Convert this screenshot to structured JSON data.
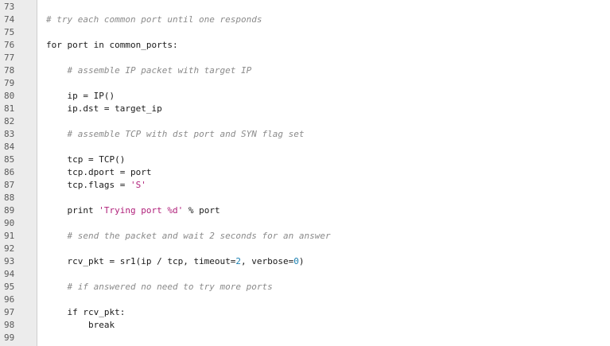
{
  "editor": {
    "lines": [
      {
        "number": "73",
        "indent": "",
        "tokens": []
      },
      {
        "number": "74",
        "indent": "",
        "tokens": [
          {
            "type": "comment",
            "text": "# try each common port until one responds"
          }
        ]
      },
      {
        "number": "75",
        "indent": "",
        "tokens": []
      },
      {
        "number": "76",
        "indent": "",
        "tokens": [
          {
            "type": "plain",
            "text": "for port in common_ports:"
          }
        ]
      },
      {
        "number": "77",
        "indent": "",
        "tokens": []
      },
      {
        "number": "78",
        "indent": "    ",
        "tokens": [
          {
            "type": "comment",
            "text": "# assemble IP packet with target IP"
          }
        ]
      },
      {
        "number": "79",
        "indent": "",
        "tokens": []
      },
      {
        "number": "80",
        "indent": "    ",
        "tokens": [
          {
            "type": "plain",
            "text": "ip = IP()"
          }
        ]
      },
      {
        "number": "81",
        "indent": "    ",
        "tokens": [
          {
            "type": "plain",
            "text": "ip.dst = target_ip"
          }
        ]
      },
      {
        "number": "82",
        "indent": "",
        "tokens": []
      },
      {
        "number": "83",
        "indent": "    ",
        "tokens": [
          {
            "type": "comment",
            "text": "# assemble TCP with dst port and SYN flag set"
          }
        ]
      },
      {
        "number": "84",
        "indent": "",
        "tokens": []
      },
      {
        "number": "85",
        "indent": "    ",
        "tokens": [
          {
            "type": "plain",
            "text": "tcp = TCP()"
          }
        ]
      },
      {
        "number": "86",
        "indent": "    ",
        "tokens": [
          {
            "type": "plain",
            "text": "tcp.dport = port"
          }
        ]
      },
      {
        "number": "87",
        "indent": "    ",
        "tokens": [
          {
            "type": "plain",
            "text": "tcp.flags = "
          },
          {
            "type": "string",
            "text": "'S'"
          }
        ]
      },
      {
        "number": "88",
        "indent": "",
        "tokens": []
      },
      {
        "number": "89",
        "indent": "    ",
        "tokens": [
          {
            "type": "plain",
            "text": "print "
          },
          {
            "type": "string",
            "text": "'Trying port %d'"
          },
          {
            "type": "plain",
            "text": " % port"
          }
        ]
      },
      {
        "number": "90",
        "indent": "",
        "tokens": []
      },
      {
        "number": "91",
        "indent": "    ",
        "tokens": [
          {
            "type": "comment",
            "text": "# send the packet and wait 2 seconds for an answer"
          }
        ]
      },
      {
        "number": "92",
        "indent": "",
        "tokens": []
      },
      {
        "number": "93",
        "indent": "    ",
        "tokens": [
          {
            "type": "plain",
            "text": "rcv_pkt = sr1(ip / tcp, timeout="
          },
          {
            "type": "number",
            "text": "2"
          },
          {
            "type": "plain",
            "text": ", verbose="
          },
          {
            "type": "number",
            "text": "0"
          },
          {
            "type": "plain",
            "text": ")"
          }
        ]
      },
      {
        "number": "94",
        "indent": "",
        "tokens": []
      },
      {
        "number": "95",
        "indent": "    ",
        "tokens": [
          {
            "type": "comment",
            "text": "# if answered no need to try more ports"
          }
        ]
      },
      {
        "number": "96",
        "indent": "",
        "tokens": []
      },
      {
        "number": "97",
        "indent": "    ",
        "tokens": [
          {
            "type": "plain",
            "text": "if rcv_pkt:"
          }
        ]
      },
      {
        "number": "98",
        "indent": "        ",
        "tokens": [
          {
            "type": "plain",
            "text": "break"
          }
        ]
      },
      {
        "number": "99",
        "indent": "",
        "tokens": []
      }
    ]
  },
  "colors": {
    "gutter_bg": "#ececec",
    "line_number": "#5a5a5a",
    "comment": "#8a8a8a",
    "string": "#b0207a",
    "number": "#1a7fb0",
    "text": "#1a1a1a"
  }
}
